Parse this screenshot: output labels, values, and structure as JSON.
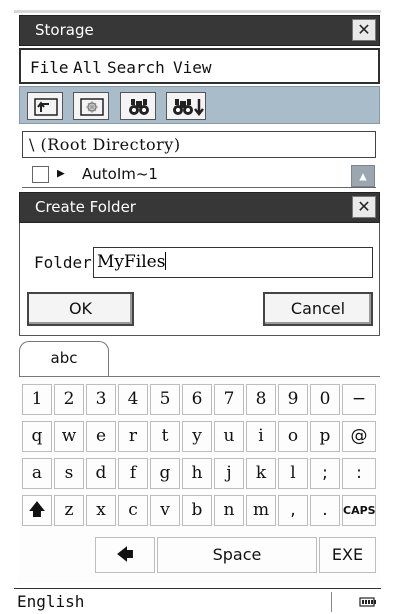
{
  "storage_window": {
    "title": "Storage",
    "close_glyph": "✕",
    "menu": [
      "File",
      "All",
      "Search",
      "View"
    ],
    "toolbar_icons": [
      "parent-folder-icon",
      "new-folder-icon",
      "search-icon",
      "search-next-icon"
    ],
    "directory": "\\ (Root Directory)",
    "file_item": {
      "name": "AutoIm~1",
      "expand_glyph": "▶",
      "scroll_glyph": "▲"
    }
  },
  "create_folder": {
    "title": "Create Folder",
    "close_glyph": "✕",
    "folder_label": "Folder:",
    "folder_value": "MyFiles",
    "ok_label": "OK",
    "cancel_label": "Cancel"
  },
  "keyboard": {
    "tab_label": "abc",
    "rows": [
      [
        "1",
        "2",
        "3",
        "4",
        "5",
        "6",
        "7",
        "8",
        "9",
        "0",
        "−"
      ],
      [
        "q",
        "w",
        "e",
        "r",
        "t",
        "y",
        "u",
        "i",
        "o",
        "p",
        "@"
      ],
      [
        "a",
        "s",
        "d",
        "f",
        "g",
        "h",
        "j",
        "k",
        "l",
        ";",
        ":"
      ],
      [
        "🡅",
        "z",
        "x",
        "c",
        "v",
        "b",
        "n",
        "m",
        ",",
        ".",
        "CAPS"
      ]
    ],
    "backspace_glyph": "🡄",
    "space_label": "Space",
    "exe_label": "EXE"
  },
  "status_bar": {
    "language": "English",
    "battery_icon": "battery-icon"
  }
}
